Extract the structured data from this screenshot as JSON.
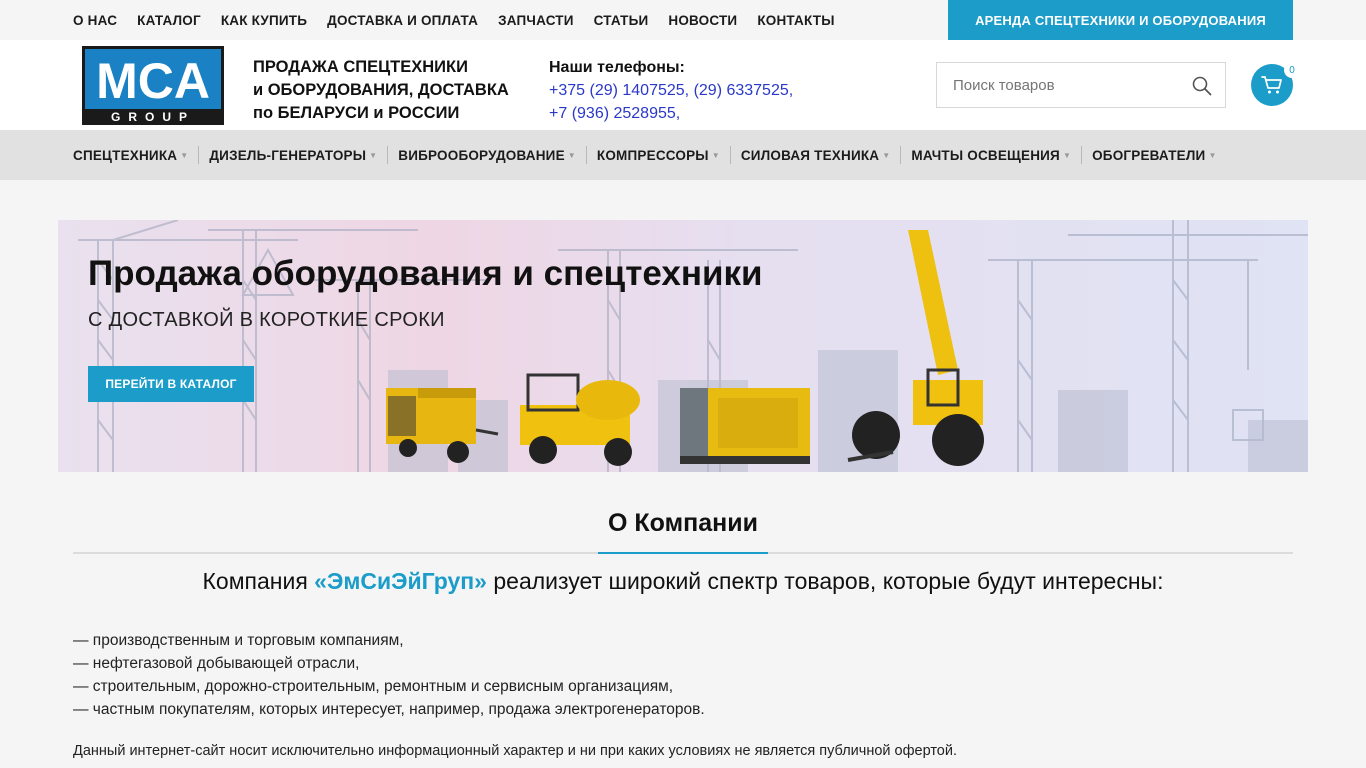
{
  "topbar": {
    "links": [
      "О НАС",
      "КАТАЛОГ",
      "КАК КУПИТЬ",
      "ДОСТАВКА И ОПЛАТА",
      "ЗАПЧАСТИ",
      "СТАТЬИ",
      "НОВОСТИ",
      "КОНТАКТЫ"
    ],
    "rent_button": "АРЕНДА СПЕЦТЕХНИКИ И ОБОРУДОВАНИЯ"
  },
  "header": {
    "logo_letters": "MCA",
    "logo_sub": "GROUP",
    "tagline": [
      "ПРОДАЖА СПЕЦТЕХНИКИ",
      "и ОБОРУДОВАНИЯ, ДОСТАВКА",
      "по БЕЛАРУСИ и РОССИИ"
    ],
    "phones_title": "Наши телефоны:",
    "phones": [
      "+375 (29) 1407525, (29) 6337525,",
      "+7 (936) 2528955,"
    ],
    "search_placeholder": "Поиск товаров",
    "cart_count": "0"
  },
  "catnav": {
    "items": [
      "СПЕЦТЕХНИКА",
      "ДИЗЕЛЬ-ГЕНЕРАТОРЫ",
      "ВИБРООБОРУДОВАНИЕ",
      "КОМПРЕССОРЫ",
      "СИЛОВАЯ ТЕХНИКА",
      "МАЧТЫ ОСВЕЩЕНИЯ",
      "ОБОГРЕВАТЕЛИ"
    ]
  },
  "hero": {
    "title": "Продажа оборудования и спецтехники",
    "subtitle": "С ДОСТАВКОЙ В КОРОТКИЕ СРОКИ",
    "button": "ПЕРЕЙТИ В КАТАЛОГ"
  },
  "about": {
    "title": "О Компании",
    "lead_before": "Компания ",
    "lead_brand": "«ЭмСиЭйГруп»",
    "lead_after": " реализует широкий спектр товаров, которые будут интересны:",
    "list": [
      "— производственным и торговым компаниям,",
      "— нефтегазовой добывающей отрасли,",
      "— строительным, дорожно-строительным, ремонтным и сервисным организациям,",
      "— частным покупателям, которых интересует, например, продажа электрогенераторов."
    ],
    "note": "Данный интернет-сайт носит исключительно информационный характер и ни при каких условиях не является публичной офертой."
  },
  "colors": {
    "accent": "#1b9cc9",
    "phone_link": "#2a38c8",
    "nav_bg": "#e1e1e1"
  }
}
